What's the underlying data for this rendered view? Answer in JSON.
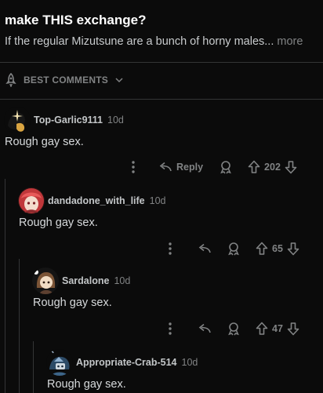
{
  "post": {
    "title": "make THIS exchange?",
    "snippet": "If the regular Mizutsune are a bunch of horny males...",
    "more_label": "more"
  },
  "sort": {
    "label": "BEST COMMENTS",
    "icon": "rocket-icon"
  },
  "comments": [
    {
      "username": "Top-Garlic9111",
      "age": "10d",
      "body": "Rough gay sex.",
      "reply_label": "Reply",
      "votes": "202"
    },
    {
      "username": "dandadone_with_life",
      "age": "10d",
      "body": "Rough gay sex.",
      "votes": "65"
    },
    {
      "username": "Sardalone",
      "age": "10d",
      "body": "Rough gay sex.",
      "votes": "47"
    },
    {
      "username": "Appropriate-Crab-514",
      "age": "10d",
      "body": "Rough gay sex."
    }
  ]
}
